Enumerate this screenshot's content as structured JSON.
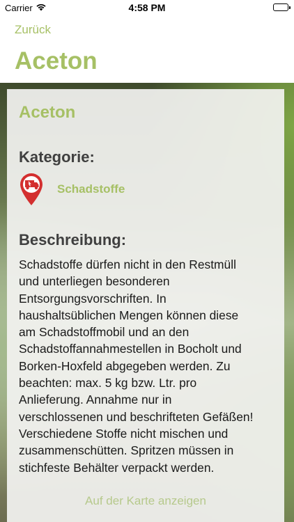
{
  "status_bar": {
    "carrier": "Carrier",
    "time": "4:58 PM"
  },
  "nav": {
    "back_label": "Zurück",
    "title": "Aceton"
  },
  "card": {
    "title": "Aceton",
    "category_heading": "Kategorie:",
    "category_icon": "truck-location-pin-icon",
    "category_label": "Schadstoffe",
    "description_heading": "Beschreibung:",
    "description": "Schadstoffe dürfen nicht in den Restmüll\nund unterliegen besonderen\nEntsorgungsvorschriften. In\nhaushaltsüblichen Mengen können diese\nam Schadstoffmobil und an den\nSchadstoffannahmestellen in Bocholt und\nBorken-Hoxfeld abgegeben werden. Zu\nbeachten:  max. 5 kg bzw. Ltr.  pro\nAnlieferung. Annahme nur in\nverschlossenen und beschrifteten Gefäßen!\nVerschiedene Stoffe nicht mischen und\nzusammenschütten. Spritzen müssen in\nstichfeste Behälter verpackt werden.",
    "map_link_label": "Auf der Karte anzeigen"
  },
  "colors": {
    "accent": "#a6c065",
    "heading": "#3f3f3f",
    "pin": "#d32f2f"
  }
}
